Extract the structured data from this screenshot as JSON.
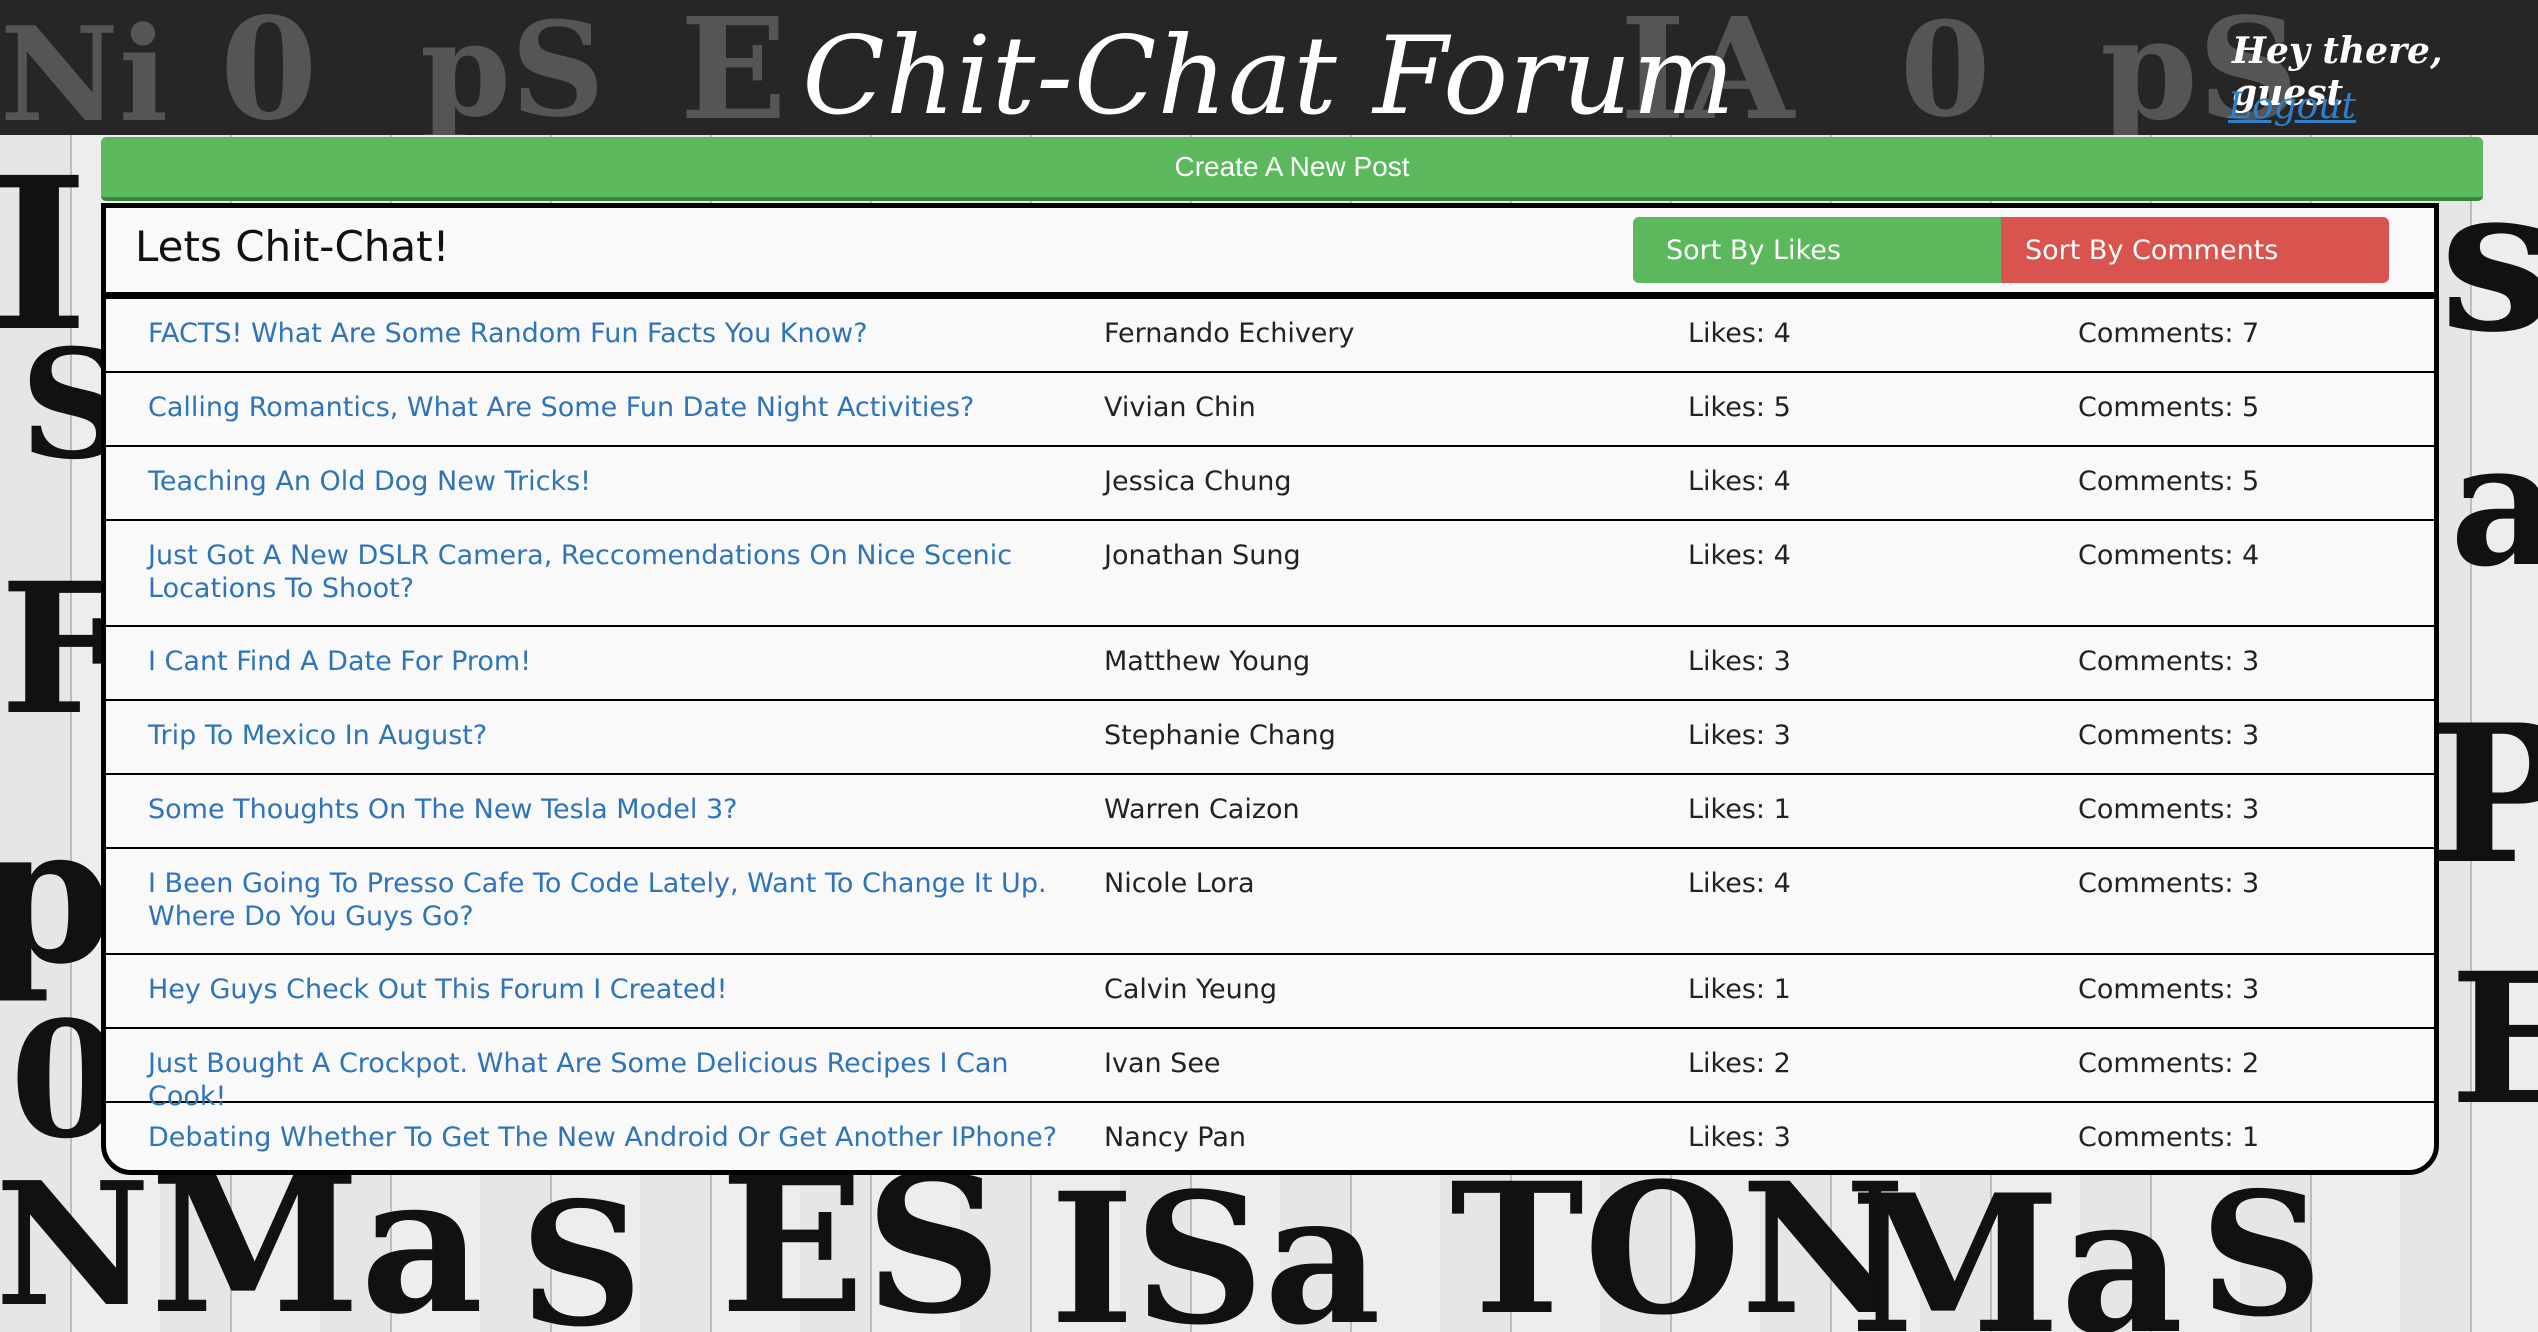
{
  "header": {
    "title": "Chit-Chat Forum",
    "greeting": "Hey there, guest",
    "logout_label": "Logout"
  },
  "create_post_label": "Create A New Post",
  "panel": {
    "title": "Lets Chit-Chat!",
    "sort_likes_label": "Sort By Likes",
    "sort_comments_label": "Sort By Comments"
  },
  "posts": [
    {
      "title": "FACTS! What Are Some Random Fun Facts You Know?",
      "author": "Fernando Echivery",
      "likes": "Likes: 4",
      "comments": "Comments: 7"
    },
    {
      "title": "Calling Romantics, What Are Some Fun Date Night Activities?",
      "author": "Vivian Chin",
      "likes": "Likes: 5",
      "comments": "Comments: 5"
    },
    {
      "title": "Teaching An Old Dog New Tricks!",
      "author": "Jessica Chung",
      "likes": "Likes: 4",
      "comments": "Comments: 5"
    },
    {
      "title": "Just Got A New DSLR Camera, Reccomendations On Nice Scenic Locations To Shoot?",
      "author": "Jonathan Sung",
      "likes": "Likes: 4",
      "comments": "Comments: 4"
    },
    {
      "title": "I Cant Find A Date For Prom!",
      "author": "Matthew Young",
      "likes": "Likes: 3",
      "comments": "Comments: 3"
    },
    {
      "title": "Trip To Mexico In August?",
      "author": "Stephanie Chang",
      "likes": "Likes: 3",
      "comments": "Comments: 3"
    },
    {
      "title": "Some Thoughts On The New Tesla Model 3?",
      "author": "Warren Caizon",
      "likes": "Likes: 1",
      "comments": "Comments: 3"
    },
    {
      "title": "I Been Going To Presso Cafe To Code Lately, Want To Change It Up. Where Do You Guys Go?",
      "author": "Nicole Lora",
      "likes": "Likes: 4",
      "comments": "Comments: 3"
    },
    {
      "title": "Hey Guys Check Out This Forum I Created!",
      "author": "Calvin Yeung",
      "likes": "Likes: 1",
      "comments": "Comments: 3"
    },
    {
      "title": "Just Bought A Crockpot. What Are Some Delicious Recipes I Can Cook!",
      "author": "Ivan See",
      "likes": "Likes: 2",
      "comments": "Comments: 2"
    },
    {
      "title": "Debating Whether To Get The New Android Or Get Another IPhone?",
      "author": "Nancy Pan",
      "likes": "Likes: 3",
      "comments": "Comments: 1"
    }
  ],
  "colors": {
    "accent_green": "#5cb85c",
    "accent_red": "#d9534f",
    "link_blue": "#2f73b8"
  }
}
